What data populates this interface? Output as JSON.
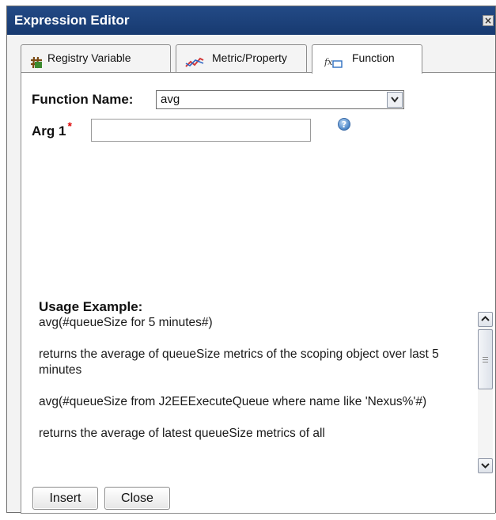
{
  "window": {
    "title": "Expression Editor",
    "close_glyph": "×"
  },
  "tabs": [
    {
      "label": "Registry Variable",
      "icon": "registry-variable-icon",
      "active": false
    },
    {
      "label": "Metric/Property",
      "icon": "metric-property-icon",
      "active": false
    },
    {
      "label": "Function",
      "icon": "function-icon",
      "active": true
    }
  ],
  "form": {
    "function_name_label": "Function Name:",
    "function_name_value": "avg",
    "arg1_label": "Arg 1",
    "arg1_required_mark": "*",
    "arg1_value": "",
    "help_glyph": "?"
  },
  "usage": {
    "title": "Usage Example:",
    "lines": [
      "avg(#queueSize for 5 minutes#)",
      "returns the average of queueSize metrics of the scoping object over last 5 minutes",
      "avg(#queueSize from J2EEExecuteQueue where name like 'Nexus%'#)",
      "returns the average of latest queueSize metrics of all"
    ]
  },
  "buttons": {
    "insert": "Insert",
    "close": "Close"
  },
  "colors": {
    "titlebar": "#1d4179",
    "required": "#dd0000",
    "help": "#4b86c8"
  }
}
